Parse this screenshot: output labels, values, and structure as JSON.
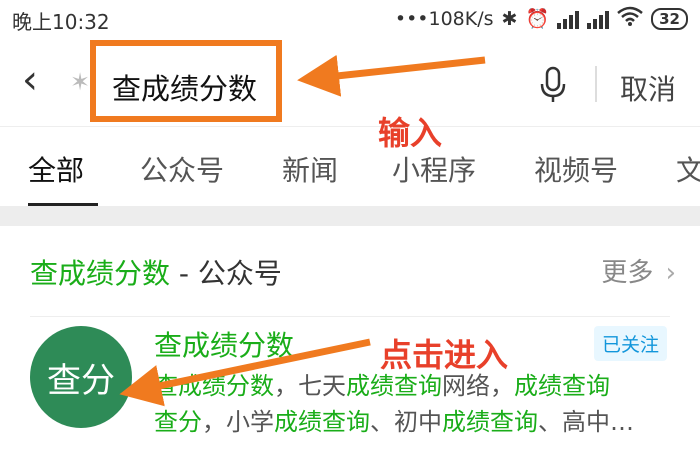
{
  "status": {
    "time": "晚上10:32",
    "network_speed": "•••108K/s",
    "bluetooth_icon": "bluetooth-icon",
    "alarm_icon": "alarm-icon",
    "wifi_icon": "wifi-icon",
    "battery": "32"
  },
  "search": {
    "back_icon": "chevron-left-icon",
    "query": "查成绩分数",
    "mic_icon": "microphone-icon",
    "cancel_label": "取消"
  },
  "annotations": {
    "input_label": "输入",
    "click_label": "点击进入"
  },
  "tabs": [
    {
      "label": "全部",
      "active": true
    },
    {
      "label": "公众号",
      "active": false
    },
    {
      "label": "新闻",
      "active": false
    },
    {
      "label": "小程序",
      "active": false
    },
    {
      "label": "视频号",
      "active": false
    },
    {
      "label": "文",
      "active": false
    }
  ],
  "result": {
    "section_query": "查成绩分数",
    "section_type": " - 公众号",
    "more_label": "更多",
    "more_icon": "chevron-right-icon",
    "avatar_text": "查分",
    "account_name": "查成绩分数",
    "followed_badge": "已关注",
    "desc_line1": [
      {
        "text": "查成绩分数",
        "hl": true
      },
      {
        "text": "，七天",
        "hl": false
      },
      {
        "text": "成绩查询",
        "hl": true
      },
      {
        "text": "网络，",
        "hl": false
      },
      {
        "text": "成绩查询",
        "hl": true
      }
    ],
    "desc_line2": [
      {
        "text": "查分",
        "hl": true
      },
      {
        "text": "，小学",
        "hl": false
      },
      {
        "text": "成绩查询",
        "hl": true
      },
      {
        "text": "、初中",
        "hl": false
      },
      {
        "text": "成绩查询",
        "hl": true
      },
      {
        "text": "、高中…",
        "hl": false
      }
    ]
  },
  "colors": {
    "highlight_orange": "#f07a1f",
    "annotation_red": "#e8402a",
    "wechat_green": "#1aad19"
  }
}
